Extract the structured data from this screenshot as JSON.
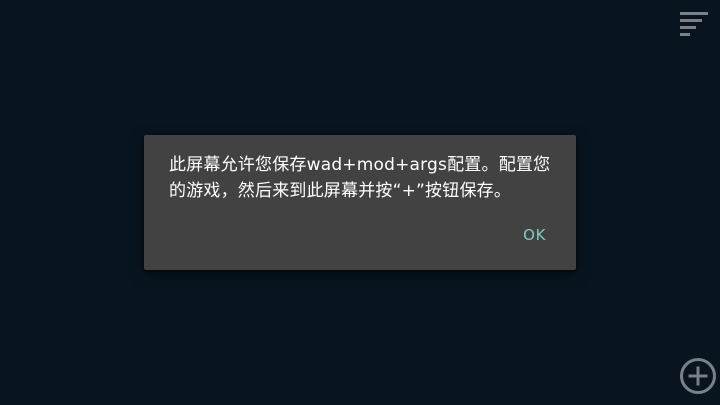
{
  "toolbar": {
    "menu_icon": "sort-menu-icon"
  },
  "dialog": {
    "message": "此屏幕允许您保存wad+mod+args配置。配置您的游戏，然后来到此屏幕并按“+”按钮保存。",
    "ok_label": "OK"
  },
  "fab": {
    "icon": "add-circle-icon"
  },
  "colors": {
    "background": "#081521",
    "dialog_background": "#424242",
    "accent": "#80cbc4",
    "icon_color": "#7a8087"
  }
}
